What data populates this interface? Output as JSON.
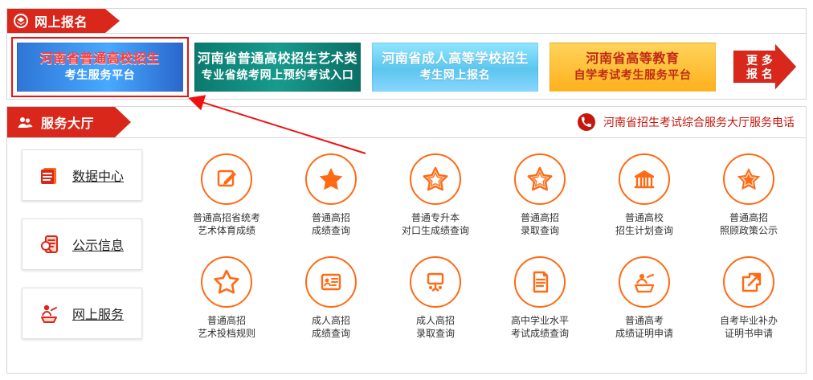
{
  "top_section": {
    "title": "网上报名",
    "banners": [
      {
        "line1": "河南省普通高校招生",
        "line2": "考生服务平台"
      },
      {
        "line1": "河南省普通高校招生艺术类",
        "line2": "专业省统考网上预约考试入口"
      },
      {
        "line1": "河南省成人高等学校招生",
        "line2": "考生网上报名"
      },
      {
        "line1": "河南省高等教育",
        "line2": "自学考试考生服务平台"
      }
    ],
    "more": {
      "line1": "更 多",
      "line2": "报 名"
    }
  },
  "hall": {
    "title": "服务大厅",
    "phone_text": "河南省招生考试综合服务大厅服务电话",
    "side_buttons": [
      {
        "label": "数据中心",
        "icon": "document-stack-icon"
      },
      {
        "label": "公示信息",
        "icon": "search-document-icon"
      },
      {
        "label": "网上服务",
        "icon": "user-laptop-icon"
      }
    ],
    "items": [
      {
        "line1": "普通高招省统考",
        "line2": "艺术体育成绩",
        "icon": "edit-icon"
      },
      {
        "line1": "普通高招",
        "line2": "成绩查询",
        "icon": "star-solid-icon"
      },
      {
        "line1": "普通专升本",
        "line2": "对口生成绩查询",
        "icon": "star-outline-icon"
      },
      {
        "line1": "普通高招",
        "line2": "录取查询",
        "icon": "star-outline-icon"
      },
      {
        "line1": "普通高校",
        "line2": "招生计划查询",
        "icon": "institution-icon"
      },
      {
        "line1": "普通高招",
        "line2": "照顾政策公示",
        "icon": "star-solid-icon"
      },
      {
        "line1": "普通高招",
        "line2": "艺术投档规则",
        "icon": "star-outline-icon"
      },
      {
        "line1": "成人高招",
        "line2": "成绩查询",
        "icon": "id-card-icon"
      },
      {
        "line1": "成人高招",
        "line2": "录取查询",
        "icon": "presentation-icon"
      },
      {
        "line1": "高中学业水平",
        "line2": "考试成绩查询",
        "icon": "document-lines-icon"
      },
      {
        "line1": "普通高考",
        "line2": "成绩证明申请",
        "icon": "person-desk-icon"
      },
      {
        "line1": "自考毕业补办",
        "line2": "证明书申请",
        "icon": "external-link-icon"
      }
    ]
  },
  "colors": {
    "red": "#d9281b",
    "orange": "#ff6a13",
    "border": "#d7d7d7"
  }
}
